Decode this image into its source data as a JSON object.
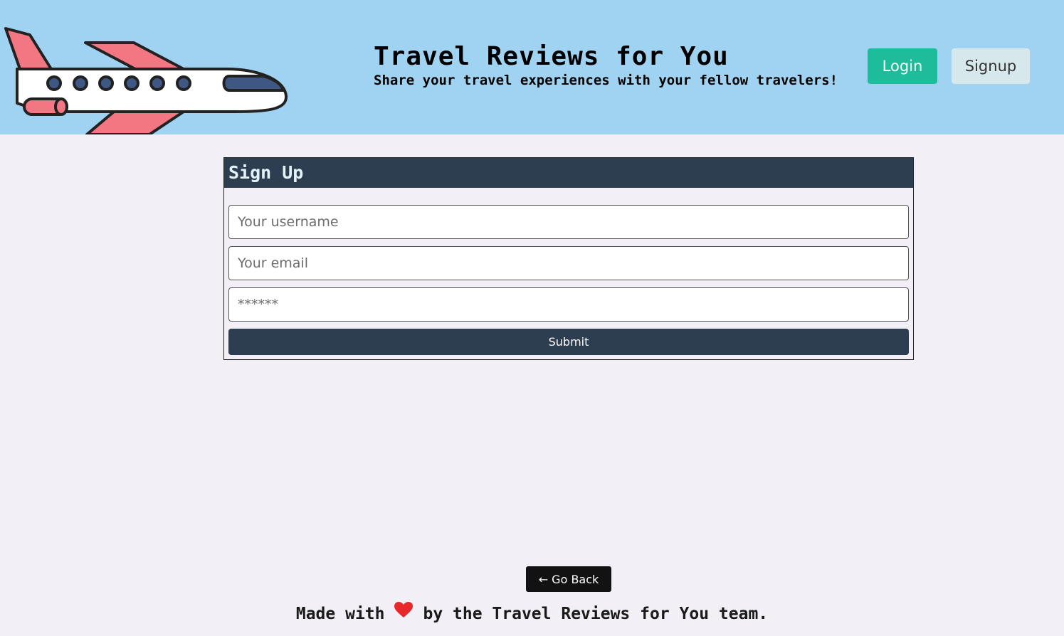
{
  "header": {
    "title": "Travel Reviews for You",
    "tagline": "Share your travel experiences with your fellow travelers!",
    "login_label": "Login",
    "signup_label": "Signup",
    "plane_icon": "airplane-icon"
  },
  "signup_form": {
    "heading": "Sign Up",
    "username_placeholder": "Your username",
    "email_placeholder": "Your email",
    "password_placeholder": "******",
    "submit_label": "Submit"
  },
  "go_back_label": "← Go Back",
  "footer": {
    "prefix": "Made with",
    "suffix": "by the Travel Reviews for You team.",
    "heart_icon": "heart-icon"
  },
  "colors": {
    "header_bg": "#a0d3f2",
    "page_bg": "#f2eff6",
    "login_bg": "#1dbc9a",
    "signup_bg": "#d6e8ec",
    "form_header_bg": "#2d3e50",
    "plane_wing": "#f27783",
    "plane_window": "#3f5883",
    "heart": "#e8272a"
  }
}
